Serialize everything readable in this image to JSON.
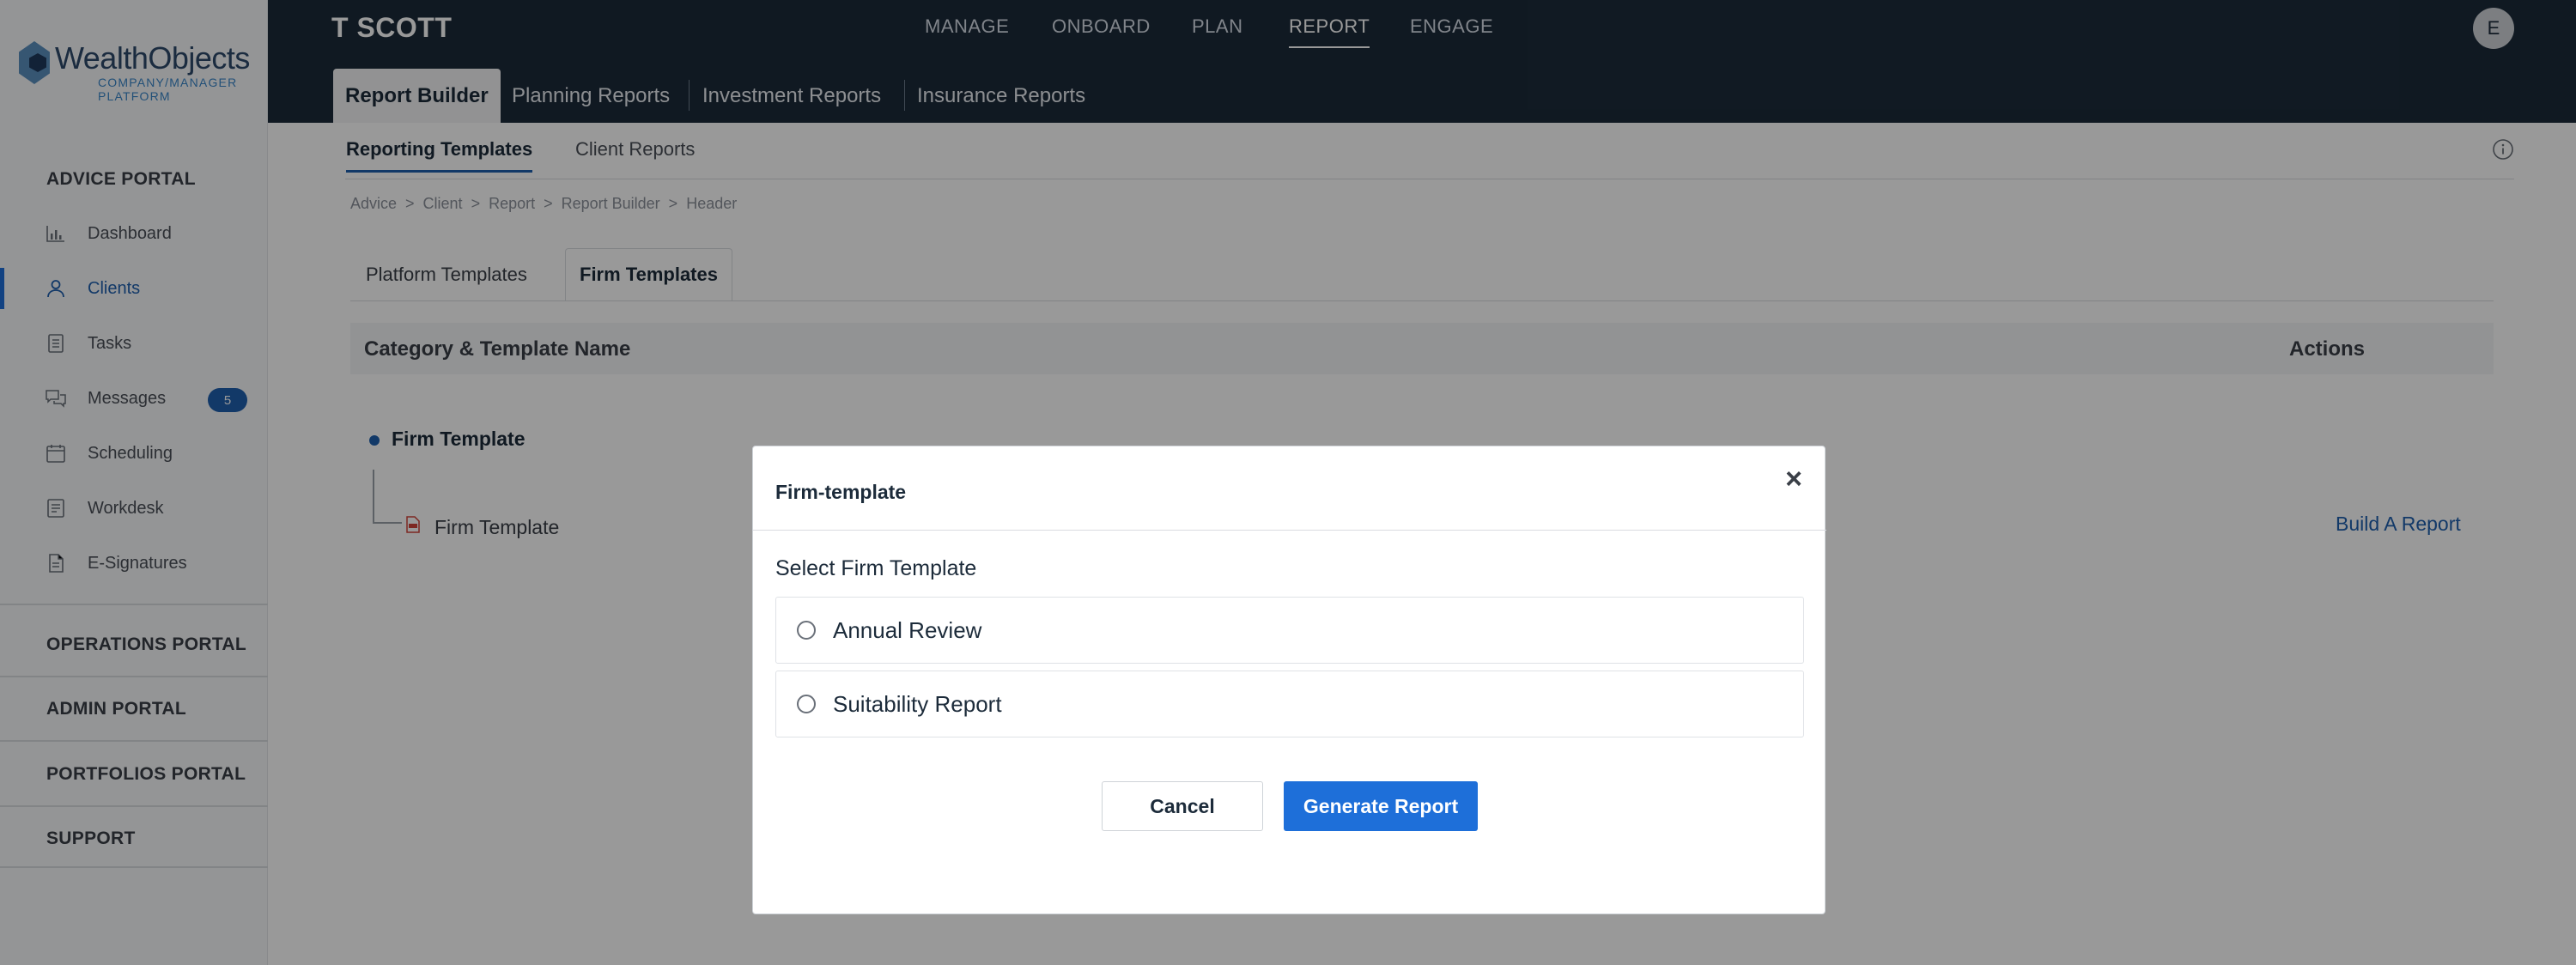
{
  "brand": {
    "name": "WealthObjects",
    "tagline": "COMPANY/MANAGER PLATFORM"
  },
  "sidebar": {
    "advice_portal": "ADVICE PORTAL",
    "items": [
      {
        "label": "Dashboard",
        "icon": "bar-chart-icon"
      },
      {
        "label": "Clients",
        "icon": "user-icon",
        "active": true
      },
      {
        "label": "Tasks",
        "icon": "task-list-icon"
      },
      {
        "label": "Messages",
        "icon": "chat-icon",
        "badge": "5"
      },
      {
        "label": "Scheduling",
        "icon": "calendar-icon"
      },
      {
        "label": "Workdesk",
        "icon": "workdesk-icon"
      },
      {
        "label": "E-Signatures",
        "icon": "document-icon"
      }
    ],
    "portals": [
      "OPERATIONS PORTAL",
      "ADMIN PORTAL",
      "PORTFOLIOS PORTAL",
      "SUPPORT"
    ]
  },
  "header": {
    "user_name": "T SCOTT",
    "nav": [
      "MANAGE",
      "ONBOARD",
      "PLAN",
      "REPORT",
      "ENGAGE"
    ],
    "active_nav": "REPORT",
    "avatar_initial": "E",
    "sub_tabs": [
      "Report Builder",
      "Planning Reports",
      "Investment Reports",
      "Insurance Reports"
    ]
  },
  "content": {
    "tabs": [
      "Reporting Templates",
      "Client Reports"
    ],
    "breadcrumb": "Advice  >  Client  >  Report  >  Report Builder  >  Header",
    "template_tabs": [
      "Platform Templates",
      "Firm Templates"
    ],
    "table": {
      "col_name": "Category & Template Name",
      "col_actions": "Actions"
    },
    "tree": {
      "root": "Firm Template",
      "child": "Firm Template",
      "action": "Build A Report"
    }
  },
  "modal": {
    "title": "Firm-template",
    "close": "×",
    "label": "Select Firm Template",
    "options": [
      "Annual Review",
      "Suitability Report"
    ],
    "cancel": "Cancel",
    "generate": "Generate Report"
  },
  "colors": {
    "navy": "#1c2b3a",
    "accent": "#1e6fd9",
    "link": "#1e5fae"
  }
}
